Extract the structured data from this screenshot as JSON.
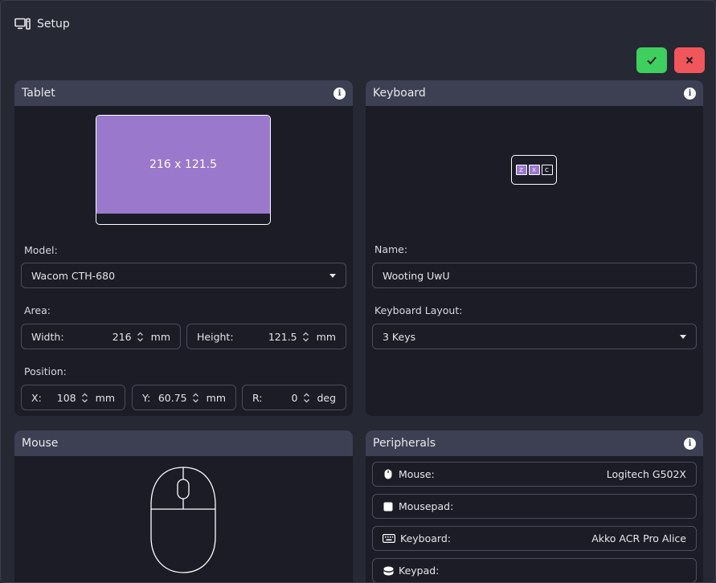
{
  "window": {
    "title": "Setup"
  },
  "actions": {
    "confirm": "✓",
    "cancel": "✕"
  },
  "tablet": {
    "header": "Tablet",
    "preview_label": "216 x 121.5",
    "model_label": "Model:",
    "model_value": "Wacom CTH-680",
    "area_label": "Area:",
    "width": {
      "label": "Width:",
      "value": "216",
      "unit": "mm"
    },
    "height": {
      "label": "Height:",
      "value": "121.5",
      "unit": "mm"
    },
    "position_label": "Position:",
    "x": {
      "label": "X:",
      "value": "108",
      "unit": "mm"
    },
    "y": {
      "label": "Y:",
      "value": "60.75",
      "unit": "mm"
    },
    "r": {
      "label": "R:",
      "value": "0",
      "unit": "deg"
    }
  },
  "keyboard": {
    "header": "Keyboard",
    "keys": [
      "Z",
      "X",
      "C"
    ],
    "name_label": "Name:",
    "name_value": "Wooting UwU",
    "layout_label": "Keyboard Layout:",
    "layout_value": "3 Keys"
  },
  "mouse": {
    "header": "Mouse"
  },
  "peripherals": {
    "header": "Peripherals",
    "items": [
      {
        "label": "Mouse:",
        "value": "Logitech G502X",
        "icon": "mouse-icon"
      },
      {
        "label": "Mousepad:",
        "value": "",
        "icon": "mousepad-icon"
      },
      {
        "label": "Keyboard:",
        "value": "Akko ACR Pro Alice",
        "icon": "keyboard-icon"
      },
      {
        "label": "Keypad:",
        "value": "",
        "icon": "keypad-icon"
      }
    ]
  },
  "colors": {
    "background": "#262834",
    "panel": "#1b1c26",
    "panel_header": "#3d4052",
    "accent": "#9a78cc",
    "confirm": "#3ecf5e",
    "cancel": "#f0565a"
  }
}
